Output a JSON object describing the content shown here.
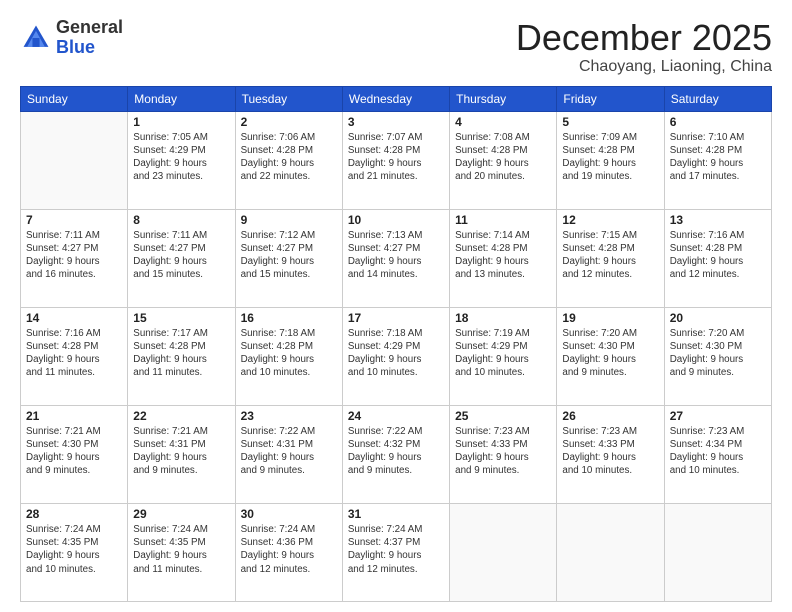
{
  "logo": {
    "general": "General",
    "blue": "Blue"
  },
  "header": {
    "month": "December 2025",
    "location": "Chaoyang, Liaoning, China"
  },
  "weekdays": [
    "Sunday",
    "Monday",
    "Tuesday",
    "Wednesday",
    "Thursday",
    "Friday",
    "Saturday"
  ],
  "weeks": [
    [
      {
        "day": "",
        "sunrise": "",
        "sunset": "",
        "daylight": ""
      },
      {
        "day": "1",
        "sunrise": "Sunrise: 7:05 AM",
        "sunset": "Sunset: 4:29 PM",
        "daylight": "Daylight: 9 hours and 23 minutes."
      },
      {
        "day": "2",
        "sunrise": "Sunrise: 7:06 AM",
        "sunset": "Sunset: 4:28 PM",
        "daylight": "Daylight: 9 hours and 22 minutes."
      },
      {
        "day": "3",
        "sunrise": "Sunrise: 7:07 AM",
        "sunset": "Sunset: 4:28 PM",
        "daylight": "Daylight: 9 hours and 21 minutes."
      },
      {
        "day": "4",
        "sunrise": "Sunrise: 7:08 AM",
        "sunset": "Sunset: 4:28 PM",
        "daylight": "Daylight: 9 hours and 20 minutes."
      },
      {
        "day": "5",
        "sunrise": "Sunrise: 7:09 AM",
        "sunset": "Sunset: 4:28 PM",
        "daylight": "Daylight: 9 hours and 19 minutes."
      },
      {
        "day": "6",
        "sunrise": "Sunrise: 7:10 AM",
        "sunset": "Sunset: 4:28 PM",
        "daylight": "Daylight: 9 hours and 17 minutes."
      }
    ],
    [
      {
        "day": "7",
        "sunrise": "Sunrise: 7:11 AM",
        "sunset": "Sunset: 4:27 PM",
        "daylight": "Daylight: 9 hours and 16 minutes."
      },
      {
        "day": "8",
        "sunrise": "Sunrise: 7:11 AM",
        "sunset": "Sunset: 4:27 PM",
        "daylight": "Daylight: 9 hours and 15 minutes."
      },
      {
        "day": "9",
        "sunrise": "Sunrise: 7:12 AM",
        "sunset": "Sunset: 4:27 PM",
        "daylight": "Daylight: 9 hours and 15 minutes."
      },
      {
        "day": "10",
        "sunrise": "Sunrise: 7:13 AM",
        "sunset": "Sunset: 4:27 PM",
        "daylight": "Daylight: 9 hours and 14 minutes."
      },
      {
        "day": "11",
        "sunrise": "Sunrise: 7:14 AM",
        "sunset": "Sunset: 4:28 PM",
        "daylight": "Daylight: 9 hours and 13 minutes."
      },
      {
        "day": "12",
        "sunrise": "Sunrise: 7:15 AM",
        "sunset": "Sunset: 4:28 PM",
        "daylight": "Daylight: 9 hours and 12 minutes."
      },
      {
        "day": "13",
        "sunrise": "Sunrise: 7:16 AM",
        "sunset": "Sunset: 4:28 PM",
        "daylight": "Daylight: 9 hours and 12 minutes."
      }
    ],
    [
      {
        "day": "14",
        "sunrise": "Sunrise: 7:16 AM",
        "sunset": "Sunset: 4:28 PM",
        "daylight": "Daylight: 9 hours and 11 minutes."
      },
      {
        "day": "15",
        "sunrise": "Sunrise: 7:17 AM",
        "sunset": "Sunset: 4:28 PM",
        "daylight": "Daylight: 9 hours and 11 minutes."
      },
      {
        "day": "16",
        "sunrise": "Sunrise: 7:18 AM",
        "sunset": "Sunset: 4:28 PM",
        "daylight": "Daylight: 9 hours and 10 minutes."
      },
      {
        "day": "17",
        "sunrise": "Sunrise: 7:18 AM",
        "sunset": "Sunset: 4:29 PM",
        "daylight": "Daylight: 9 hours and 10 minutes."
      },
      {
        "day": "18",
        "sunrise": "Sunrise: 7:19 AM",
        "sunset": "Sunset: 4:29 PM",
        "daylight": "Daylight: 9 hours and 10 minutes."
      },
      {
        "day": "19",
        "sunrise": "Sunrise: 7:20 AM",
        "sunset": "Sunset: 4:30 PM",
        "daylight": "Daylight: 9 hours and 9 minutes."
      },
      {
        "day": "20",
        "sunrise": "Sunrise: 7:20 AM",
        "sunset": "Sunset: 4:30 PM",
        "daylight": "Daylight: 9 hours and 9 minutes."
      }
    ],
    [
      {
        "day": "21",
        "sunrise": "Sunrise: 7:21 AM",
        "sunset": "Sunset: 4:30 PM",
        "daylight": "Daylight: 9 hours and 9 minutes."
      },
      {
        "day": "22",
        "sunrise": "Sunrise: 7:21 AM",
        "sunset": "Sunset: 4:31 PM",
        "daylight": "Daylight: 9 hours and 9 minutes."
      },
      {
        "day": "23",
        "sunrise": "Sunrise: 7:22 AM",
        "sunset": "Sunset: 4:31 PM",
        "daylight": "Daylight: 9 hours and 9 minutes."
      },
      {
        "day": "24",
        "sunrise": "Sunrise: 7:22 AM",
        "sunset": "Sunset: 4:32 PM",
        "daylight": "Daylight: 9 hours and 9 minutes."
      },
      {
        "day": "25",
        "sunrise": "Sunrise: 7:23 AM",
        "sunset": "Sunset: 4:33 PM",
        "daylight": "Daylight: 9 hours and 9 minutes."
      },
      {
        "day": "26",
        "sunrise": "Sunrise: 7:23 AM",
        "sunset": "Sunset: 4:33 PM",
        "daylight": "Daylight: 9 hours and 10 minutes."
      },
      {
        "day": "27",
        "sunrise": "Sunrise: 7:23 AM",
        "sunset": "Sunset: 4:34 PM",
        "daylight": "Daylight: 9 hours and 10 minutes."
      }
    ],
    [
      {
        "day": "28",
        "sunrise": "Sunrise: 7:24 AM",
        "sunset": "Sunset: 4:35 PM",
        "daylight": "Daylight: 9 hours and 10 minutes."
      },
      {
        "day": "29",
        "sunrise": "Sunrise: 7:24 AM",
        "sunset": "Sunset: 4:35 PM",
        "daylight": "Daylight: 9 hours and 11 minutes."
      },
      {
        "day": "30",
        "sunrise": "Sunrise: 7:24 AM",
        "sunset": "Sunset: 4:36 PM",
        "daylight": "Daylight: 9 hours and 12 minutes."
      },
      {
        "day": "31",
        "sunrise": "Sunrise: 7:24 AM",
        "sunset": "Sunset: 4:37 PM",
        "daylight": "Daylight: 9 hours and 12 minutes."
      },
      {
        "day": "",
        "sunrise": "",
        "sunset": "",
        "daylight": ""
      },
      {
        "day": "",
        "sunrise": "",
        "sunset": "",
        "daylight": ""
      },
      {
        "day": "",
        "sunrise": "",
        "sunset": "",
        "daylight": ""
      }
    ]
  ]
}
